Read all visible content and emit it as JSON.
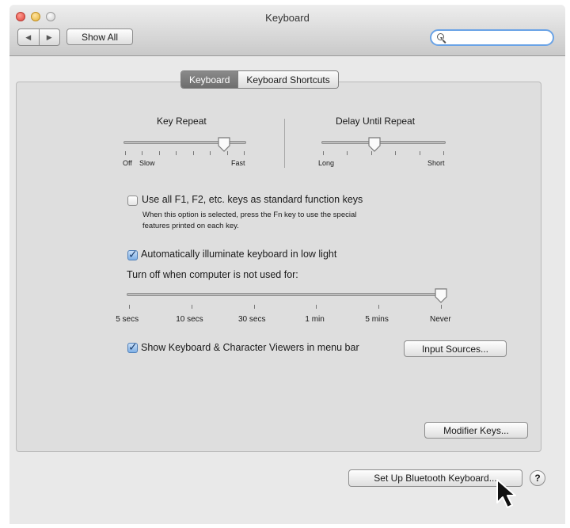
{
  "window": {
    "title": "Keyboard",
    "nav_back": "◀",
    "nav_forward": "▶",
    "show_all": "Show All",
    "search_placeholder": "",
    "search_caret": "▾"
  },
  "tabs": [
    {
      "label": "Keyboard",
      "active": true
    },
    {
      "label": "Keyboard Shortcuts",
      "active": false
    }
  ],
  "key_repeat": {
    "label": "Key Repeat",
    "left_labels": [
      "Off",
      "Slow"
    ],
    "right_label": "Fast",
    "value_fraction": 0.83
  },
  "delay_until_repeat": {
    "label": "Delay Until Repeat",
    "left_label": "Long",
    "right_label": "Short",
    "value_fraction": 0.43
  },
  "function_keys": {
    "checked": false,
    "label": "Use all F1, F2, etc. keys as standard function keys",
    "description_line1": "When this option is selected, press the Fn key to use the special",
    "description_line2": "features printed on each key."
  },
  "illuminate": {
    "checked": true,
    "label": "Automatically illuminate keyboard in low light"
  },
  "turn_off": {
    "label": "Turn off when computer is not used for:",
    "ticks": [
      "5 secs",
      "10 secs",
      "30 secs",
      "1 min",
      "5 mins",
      "Never"
    ],
    "selected": "Never"
  },
  "viewers": {
    "checked": true,
    "label": "Show Keyboard & Character Viewers in menu bar"
  },
  "buttons": {
    "input_sources": "Input Sources...",
    "modifier_keys": "Modifier Keys...",
    "bluetooth": "Set Up Bluetooth Keyboard...",
    "help": "?"
  },
  "colors": {
    "window_bg": "#e9e9e9",
    "panel_bg": "#dedede",
    "accent_search_border": "#6aa3e6",
    "checkbox_on": "#7fb0e6"
  },
  "icons": [
    "close-icon",
    "minimize-icon",
    "zoom-icon",
    "back-arrow-icon",
    "forward-arrow-icon",
    "search-icon",
    "slider-knob-icon",
    "checkmark-icon",
    "help-icon",
    "mouse-pointer-icon"
  ]
}
